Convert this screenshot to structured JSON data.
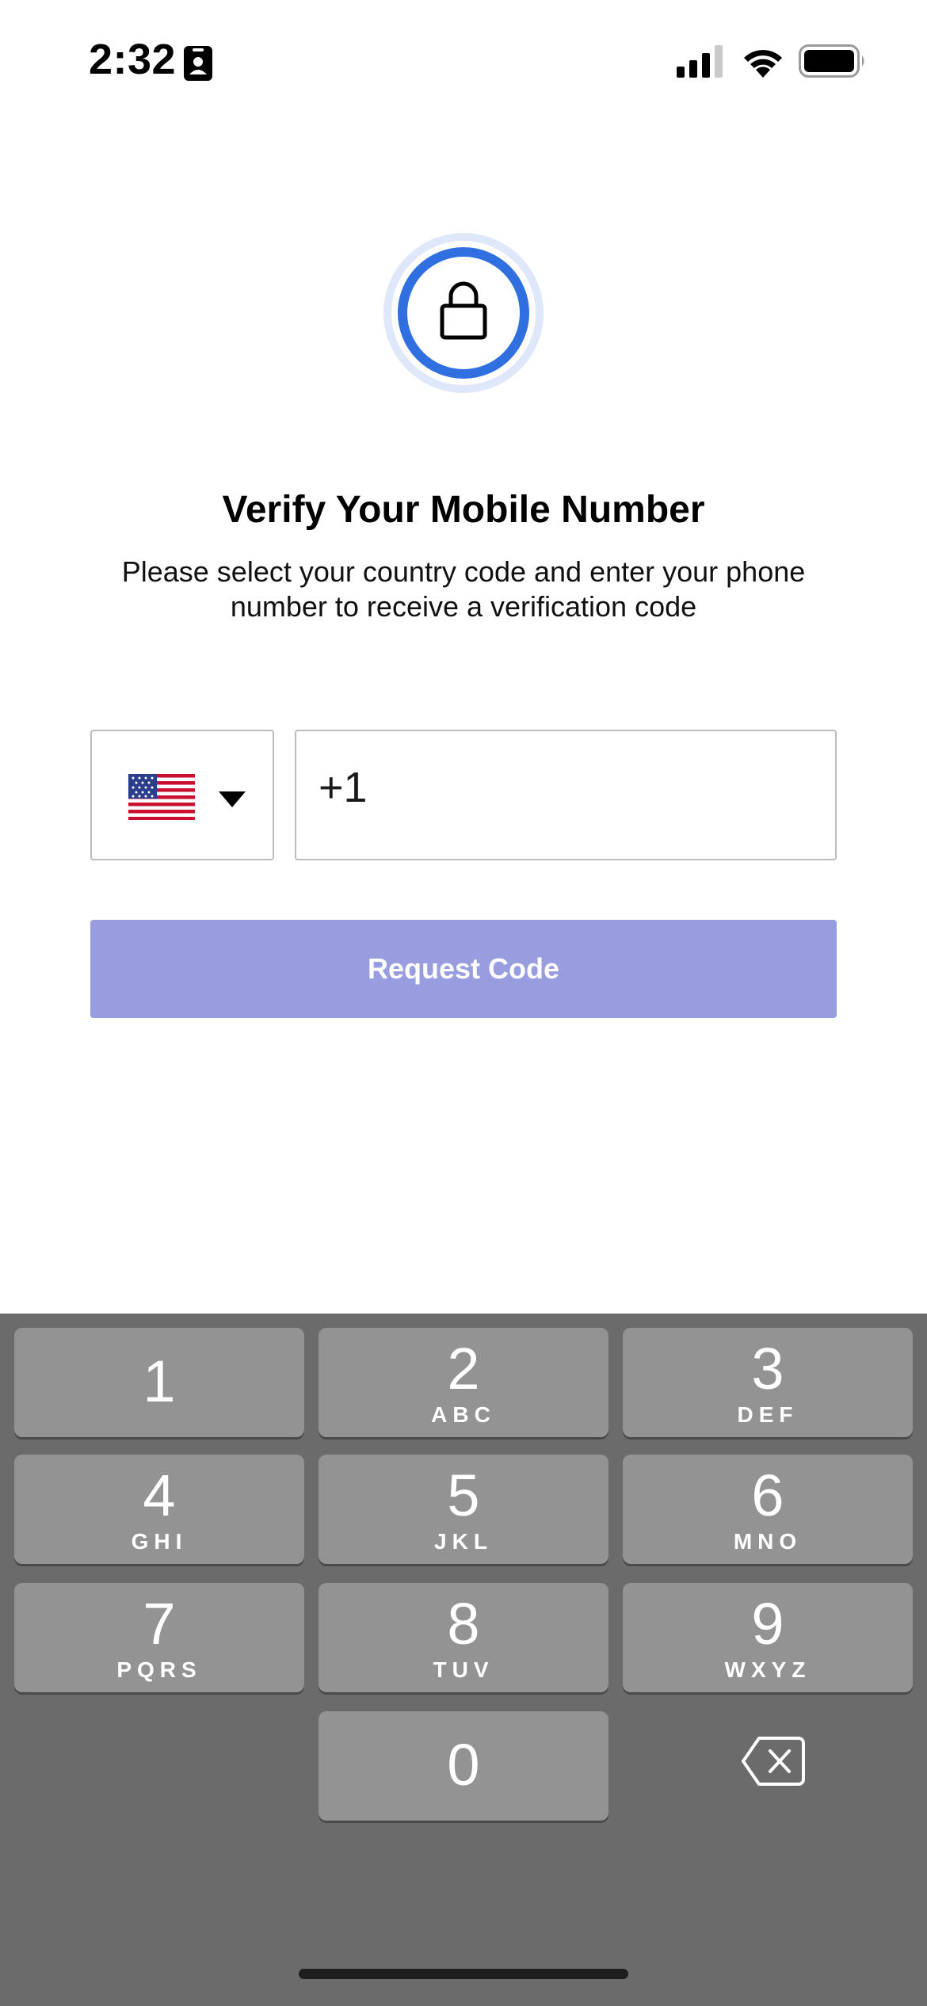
{
  "status_bar": {
    "time": "2:32",
    "icons": [
      "id-card-icon",
      "cellular-signal-icon",
      "wifi-icon",
      "battery-icon"
    ]
  },
  "verify": {
    "badge_icon": "lock-icon",
    "title": "Verify Your Mobile Number",
    "subtitle": "Please select your country code and enter your phone number to receive a verification code",
    "country": {
      "flag": "🇺🇸",
      "icon": "us-flag-icon"
    },
    "phone_value": "+1",
    "request_button": "Request Code",
    "colors": {
      "accent": "#2f6fdf",
      "button": "#979ddf",
      "badge_ring": "#dfe7fb"
    }
  },
  "keypad": {
    "keys": [
      {
        "digit": "1",
        "letters": ""
      },
      {
        "digit": "2",
        "letters": "ABC"
      },
      {
        "digit": "3",
        "letters": "DEF"
      },
      {
        "digit": "4",
        "letters": "GHI"
      },
      {
        "digit": "5",
        "letters": "JKL"
      },
      {
        "digit": "6",
        "letters": "MNO"
      },
      {
        "digit": "7",
        "letters": "PQRS"
      },
      {
        "digit": "8",
        "letters": "TUV"
      },
      {
        "digit": "9",
        "letters": "WXYZ"
      },
      {
        "digit": "0",
        "letters": ""
      }
    ],
    "delete_icon": "delete-backspace-icon",
    "colors": {
      "background": "#6b6b6b",
      "key": "#939393"
    }
  }
}
